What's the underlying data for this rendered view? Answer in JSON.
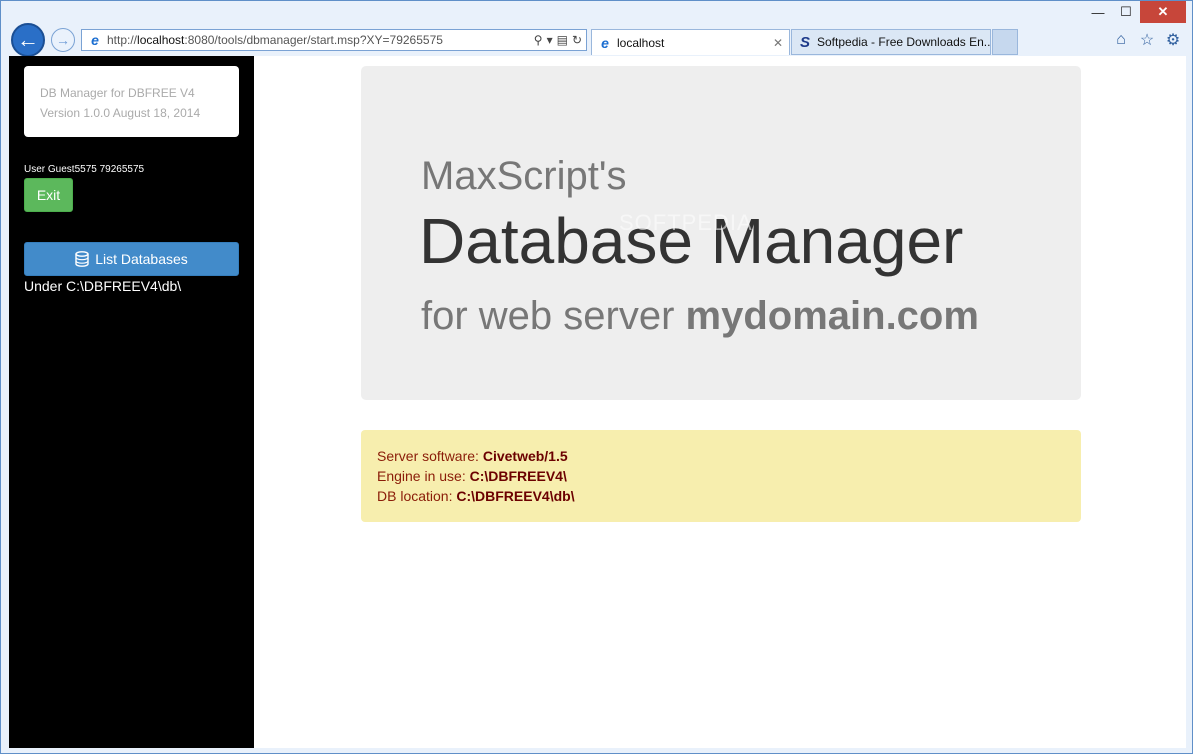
{
  "browser": {
    "url_prefix": "http://",
    "url_host": "localhost",
    "url_rest": ":8080/tools/dbmanager/start.msp?XY=79265575",
    "tabs": [
      {
        "label": "localhost"
      },
      {
        "label": "Softpedia - Free Downloads En..."
      }
    ],
    "window_controls": {
      "minimize": "—",
      "maximize": "☐",
      "close": "✕"
    }
  },
  "sidebar": {
    "brand_line1": "DB Manager for DBFREE V4",
    "brand_line2": "Version 1.0.0 August 18, 2014",
    "user_line": "User Guest5575 79265575",
    "exit_label": "Exit",
    "list_db_label": "List Databases",
    "under_path": "Under C:\\DBFREEV4\\db\\"
  },
  "hero": {
    "pre": "MaxScript's",
    "title": "Database Manager",
    "sub_prefix": "for web server ",
    "sub_domain": "mydomain.com",
    "watermark": "SOFTPEDIA"
  },
  "info": {
    "server_label": "Server software: ",
    "server_value": "Civetweb/1.5",
    "engine_label": "Engine in use: ",
    "engine_value": "C:\\DBFREEV4\\",
    "location_label": "DB location: ",
    "location_value": "C:\\DBFREEV4\\db\\"
  },
  "colors": {
    "success": "#5cb85c",
    "primary": "#428bca",
    "alert_bg": "#f7eeae",
    "alert_text": "#8a1c08"
  }
}
